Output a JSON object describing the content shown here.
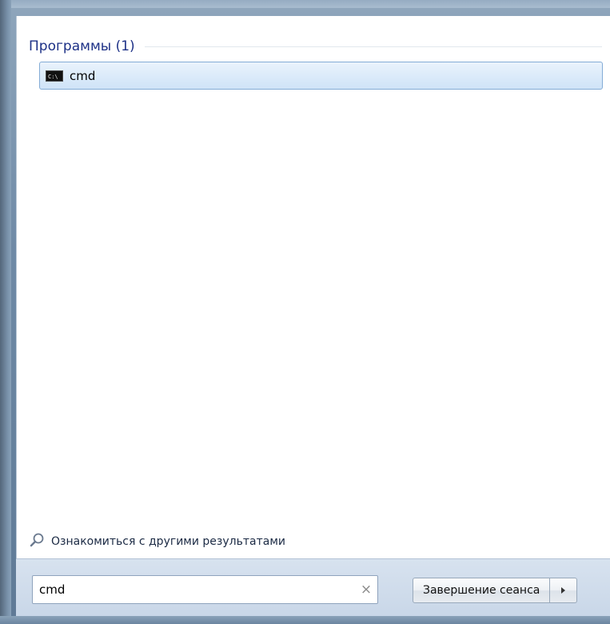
{
  "results": {
    "group_title": "Программы (1)",
    "items": [
      {
        "label": "cmd",
        "icon": "command-prompt-icon"
      }
    ]
  },
  "more_results": {
    "label": "Ознакомиться с другими результатами",
    "icon": "search-icon"
  },
  "search": {
    "value": "cmd",
    "clear_symbol": "×"
  },
  "shutdown": {
    "label": "Завершение сеанса",
    "arrow_icon": "triangle-right-icon"
  },
  "colors": {
    "group_title": "#1e3287",
    "selection_border": "#84acd6",
    "selection_fill": "#dcebfa",
    "bottom_strip": "#d7e2ef"
  }
}
